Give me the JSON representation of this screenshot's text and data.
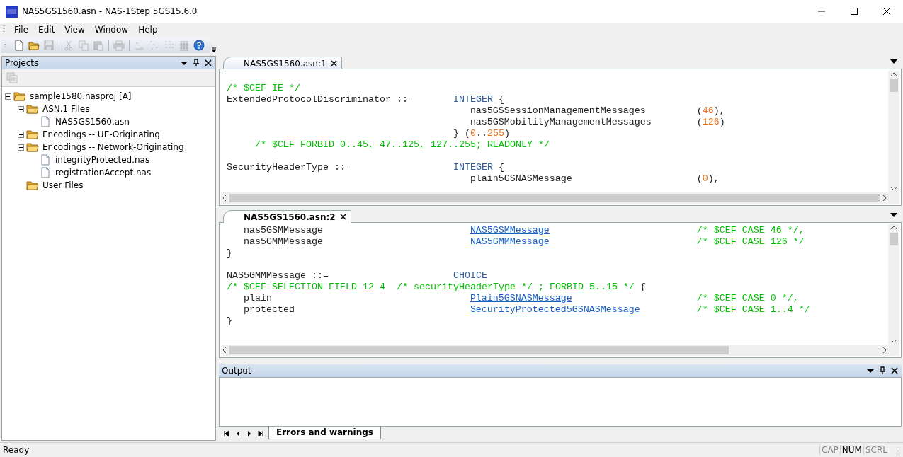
{
  "window": {
    "title": "NAS5GS1560.asn - NAS-1Step 5GS15.6.0"
  },
  "menu": [
    "File",
    "Edit",
    "View",
    "Window",
    "Help"
  ],
  "toolbar": [
    {
      "kind": "new",
      "disabled": false
    },
    {
      "kind": "open",
      "disabled": false
    },
    {
      "kind": "save",
      "disabled": true
    },
    {
      "kind": "sep"
    },
    {
      "kind": "cut",
      "disabled": true
    },
    {
      "kind": "copy",
      "disabled": true
    },
    {
      "kind": "paste",
      "disabled": true
    },
    {
      "kind": "sep"
    },
    {
      "kind": "print",
      "disabled": true
    },
    {
      "kind": "sep"
    },
    {
      "kind": "list1",
      "disabled": true
    },
    {
      "kind": "list2",
      "disabled": true
    },
    {
      "kind": "list3",
      "disabled": true
    },
    {
      "kind": "grid",
      "disabled": true
    },
    {
      "kind": "help",
      "disabled": false
    }
  ],
  "projects": {
    "title": "Projects",
    "tree": [
      {
        "label": "sample1580.nasproj [A]",
        "kind": "folder",
        "expanded": true,
        "children": [
          {
            "label": "ASN.1 Files",
            "kind": "folder",
            "expanded": true,
            "children": [
              {
                "label": "NAS5GS1560.asn",
                "kind": "file"
              }
            ]
          },
          {
            "label": "Encodings -- UE-Originating",
            "kind": "folder",
            "expanded": false
          },
          {
            "label": "Encodings -- Network-Originating",
            "kind": "folder",
            "expanded": true,
            "children": [
              {
                "label": "integrityProtected.nas",
                "kind": "file"
              },
              {
                "label": "registrationAccept.nas",
                "kind": "file"
              }
            ]
          },
          {
            "label": "User Files",
            "kind": "folder"
          }
        ]
      }
    ]
  },
  "editors": [
    {
      "tab": "NAS5GS1560.asn:1",
      "selected": false,
      "lines": [
        {
          "kind": "blank"
        },
        {
          "kind": "code",
          "start": [
            {
              "kind": "comment",
              "text": "/* $CEF IE */"
            }
          ]
        },
        {
          "kind": "code",
          "start": [
            {
              "kind": "plain",
              "text": "ExtendedProtocolDiscriminator ::="
            }
          ],
          "type": [
            {
              "kind": "keyword",
              "text": "INTEGER"
            },
            {
              "kind": "plain",
              "text": " {"
            }
          ]
        },
        {
          "kind": "code",
          "member": [
            {
              "kind": "plain",
              "text": "nas5GSSessionManagementMessages"
            }
          ],
          "value": [
            {
              "kind": "plain",
              "text": "("
            },
            {
              "kind": "number",
              "text": "46"
            },
            {
              "kind": "plain",
              "text": "),"
            }
          ]
        },
        {
          "kind": "code",
          "member": [
            {
              "kind": "plain",
              "text": "nas5GSMobilityManagementMessages"
            }
          ],
          "value": [
            {
              "kind": "plain",
              "text": "("
            },
            {
              "kind": "number",
              "text": "126"
            },
            {
              "kind": "plain",
              "text": ")"
            }
          ]
        },
        {
          "kind": "code",
          "type": [
            {
              "kind": "plain",
              "text": "} ("
            },
            {
              "kind": "number",
              "text": "0"
            },
            {
              "kind": "plain",
              "text": ".."
            },
            {
              "kind": "number",
              "text": "255"
            },
            {
              "kind": "plain",
              "text": ")"
            }
          ]
        },
        {
          "kind": "code",
          "comment_indent": [
            {
              "kind": "comment",
              "text": "/* $CEF FORBID 0..45, 47..125, 127..255; READONLY */"
            }
          ]
        },
        {
          "kind": "blank"
        },
        {
          "kind": "code",
          "start": [
            {
              "kind": "plain",
              "text": "SecurityHeaderType ::="
            }
          ],
          "type": [
            {
              "kind": "keyword",
              "text": "INTEGER"
            },
            {
              "kind": "plain",
              "text": " {"
            }
          ]
        },
        {
          "kind": "code",
          "member": [
            {
              "kind": "plain",
              "text": "plain5GSNASMessage"
            }
          ],
          "value": [
            {
              "kind": "plain",
              "text": "("
            },
            {
              "kind": "number",
              "text": "0"
            },
            {
              "kind": "plain",
              "text": "),"
            }
          ]
        }
      ]
    },
    {
      "tab": "NAS5GS1560.asn:2",
      "selected": true,
      "lines": [
        {
          "kind": "code",
          "indent": [
            {
              "kind": "plain",
              "text": "nas5GSMMessage"
            }
          ],
          "member": [
            {
              "kind": "link",
              "text": "NAS5GSMMessage"
            }
          ],
          "value": [
            {
              "kind": "comment",
              "text": "/* $CEF CASE 46 */,"
            }
          ]
        },
        {
          "kind": "code",
          "indent": [
            {
              "kind": "plain",
              "text": "nas5GMMMessage"
            }
          ],
          "member": [
            {
              "kind": "link",
              "text": "NAS5GMMMessage"
            }
          ],
          "value": [
            {
              "kind": "comment",
              "text": "/* $CEF CASE 126 */"
            }
          ]
        },
        {
          "kind": "code",
          "start": [
            {
              "kind": "plain",
              "text": "}"
            }
          ]
        },
        {
          "kind": "blank"
        },
        {
          "kind": "code",
          "start": [
            {
              "kind": "plain",
              "text": "NAS5GMMMessage ::="
            }
          ],
          "type": [
            {
              "kind": "keyword",
              "text": "CHOICE"
            }
          ]
        },
        {
          "kind": "code",
          "start": [
            {
              "kind": "comment",
              "text": "/* $CEF SELECTION FIELD 12 4  /* securityHeaderType */ ; FORBID 5..15 */"
            },
            {
              "kind": "plain",
              "text": " {"
            }
          ]
        },
        {
          "kind": "code",
          "indent": [
            {
              "kind": "plain",
              "text": "plain"
            }
          ],
          "member": [
            {
              "kind": "link",
              "text": "Plain5GSNASMessage"
            }
          ],
          "value": [
            {
              "kind": "comment",
              "text": "/* $CEF CASE 0 */,"
            }
          ]
        },
        {
          "kind": "code",
          "indent": [
            {
              "kind": "plain",
              "text": "protected"
            }
          ],
          "member": [
            {
              "kind": "link",
              "text": "SecurityProtected5GSNASMessage"
            }
          ],
          "value": [
            {
              "kind": "comment",
              "text": "/* $CEF CASE 1..4 */"
            }
          ]
        },
        {
          "kind": "code",
          "start": [
            {
              "kind": "plain",
              "text": "}"
            }
          ]
        }
      ]
    }
  ],
  "output": {
    "title": "Output",
    "tabs": [
      {
        "label": "Errors and warnings",
        "selected": true
      }
    ]
  },
  "status_bar": {
    "text": "Ready",
    "indicators": [
      {
        "label": "CAP",
        "on": false
      },
      {
        "label": "NUM",
        "on": true
      },
      {
        "label": "SCRL",
        "on": false
      }
    ]
  }
}
